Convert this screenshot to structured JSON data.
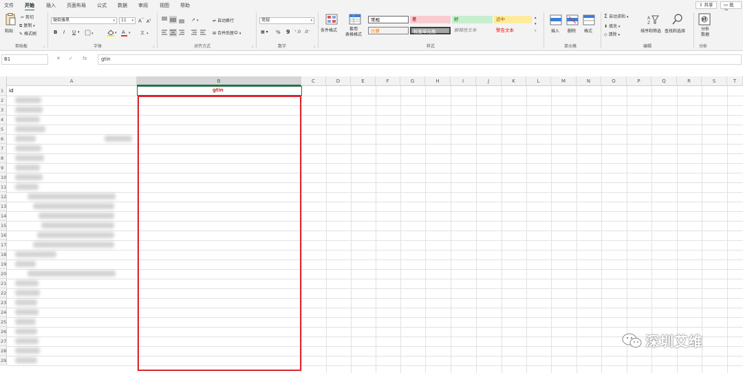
{
  "menu": {
    "tabs": [
      "文件",
      "开始",
      "插入",
      "页面布局",
      "公式",
      "数据",
      "审阅",
      "视图",
      "帮助"
    ],
    "share": "共享",
    "comments": "批注"
  },
  "ribbon": {
    "clipboard": {
      "paste": "粘贴",
      "cut": "剪切",
      "copy": "复制",
      "format_painter": "格式刷",
      "label": "剪贴板"
    },
    "font": {
      "name": "微软雅黑",
      "size": "11",
      "bold": "B",
      "italic": "I",
      "underline": "U",
      "grow": "A",
      "shrink": "A",
      "label": "字体"
    },
    "alignment": {
      "wrap": "自动换行",
      "merge": "合并后居中",
      "label": "对齐方式"
    },
    "number": {
      "format": "常规",
      "percent": "%",
      "comma": "9",
      "label": "数字"
    },
    "styles": {
      "conditional": "条件格式",
      "table": "套用\n表格格式",
      "cells": [
        "常规",
        "差",
        "好",
        "适中",
        "计算",
        "检查单元格",
        "解释性文本",
        "警告文本"
      ],
      "label": "样式"
    },
    "cells_group": {
      "insert": "插入",
      "delete": "删除",
      "format": "格式",
      "label": "单元格"
    },
    "editing": {
      "autosum": "自动求和",
      "fill": "填充",
      "clear": "清除",
      "sort": "排序和筛选",
      "find": "查找和选择",
      "label": "编辑"
    },
    "analysis": {
      "analyze": "分析\n数据",
      "label": "分析"
    }
  },
  "formula_bar": {
    "name_box": "B1",
    "value": "gtin",
    "fx": "fx"
  },
  "grid": {
    "columns": [
      "A",
      "B",
      "C",
      "D",
      "E",
      "F",
      "G",
      "H",
      "I",
      "J",
      "K",
      "L",
      "M",
      "N",
      "O",
      "P",
      "Q",
      "R",
      "S",
      "T"
    ],
    "rows": [
      "1",
      "2",
      "3",
      "4",
      "5",
      "6",
      "7",
      "8",
      "9",
      "10",
      "11",
      "12",
      "13",
      "14",
      "15",
      "16",
      "17",
      "18",
      "19",
      "20",
      "21",
      "22",
      "23",
      "24",
      "25",
      "26",
      "27",
      "28",
      "29"
    ],
    "a1": "id",
    "b1": "gtin"
  },
  "watermark": "深圳艾维",
  "colors": {
    "accent": "#217346",
    "highlight": "#d9262c"
  }
}
